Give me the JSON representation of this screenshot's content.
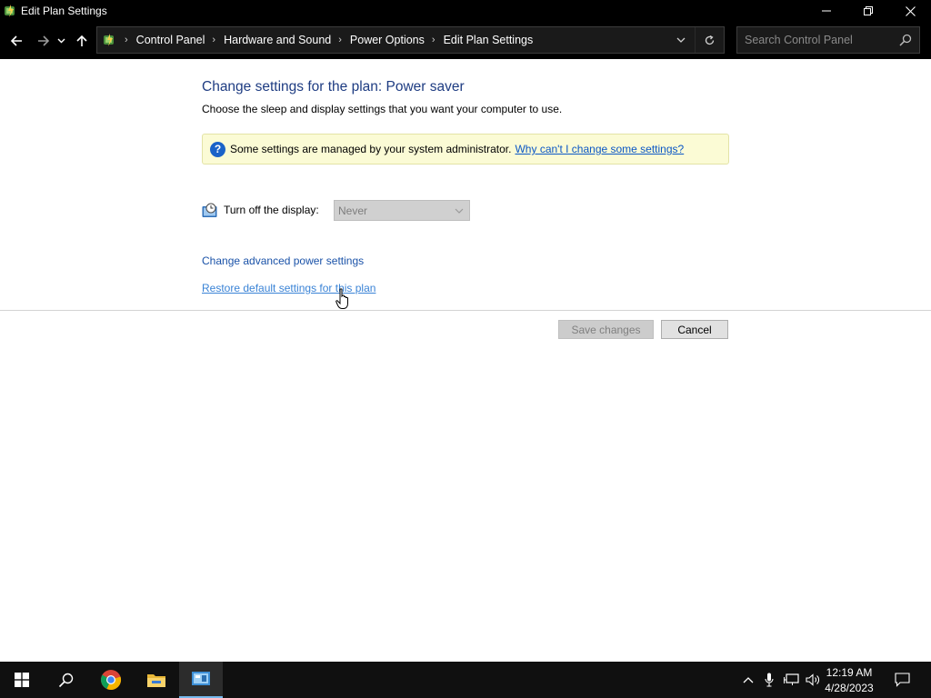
{
  "window": {
    "title": "Edit Plan Settings"
  },
  "address_bar": {
    "breadcrumbs": [
      "Control Panel",
      "Hardware and Sound",
      "Power Options",
      "Edit Plan Settings"
    ]
  },
  "search": {
    "placeholder": "Search Control Panel"
  },
  "content": {
    "heading": "Change settings for the plan: Power saver",
    "subheading": "Choose the sleep and display settings that you want your computer to use.",
    "info_bar": {
      "text": "Some settings are managed by your system administrator.",
      "link": "Why can't I change some settings?"
    },
    "display_setting": {
      "label": "Turn off the display:",
      "value": "Never"
    },
    "links": {
      "advanced": "Change advanced power settings",
      "restore": "Restore default settings for this plan"
    },
    "buttons": {
      "save": "Save changes",
      "cancel": "Cancel"
    }
  },
  "taskbar": {
    "time": "12:19 AM",
    "date": "4/28/2023"
  },
  "colors": {
    "heading": "#1e3c82",
    "link": "#0b57c5",
    "info_bg": "#fbfbd5",
    "taskbar_accent": "#76b9ed"
  }
}
